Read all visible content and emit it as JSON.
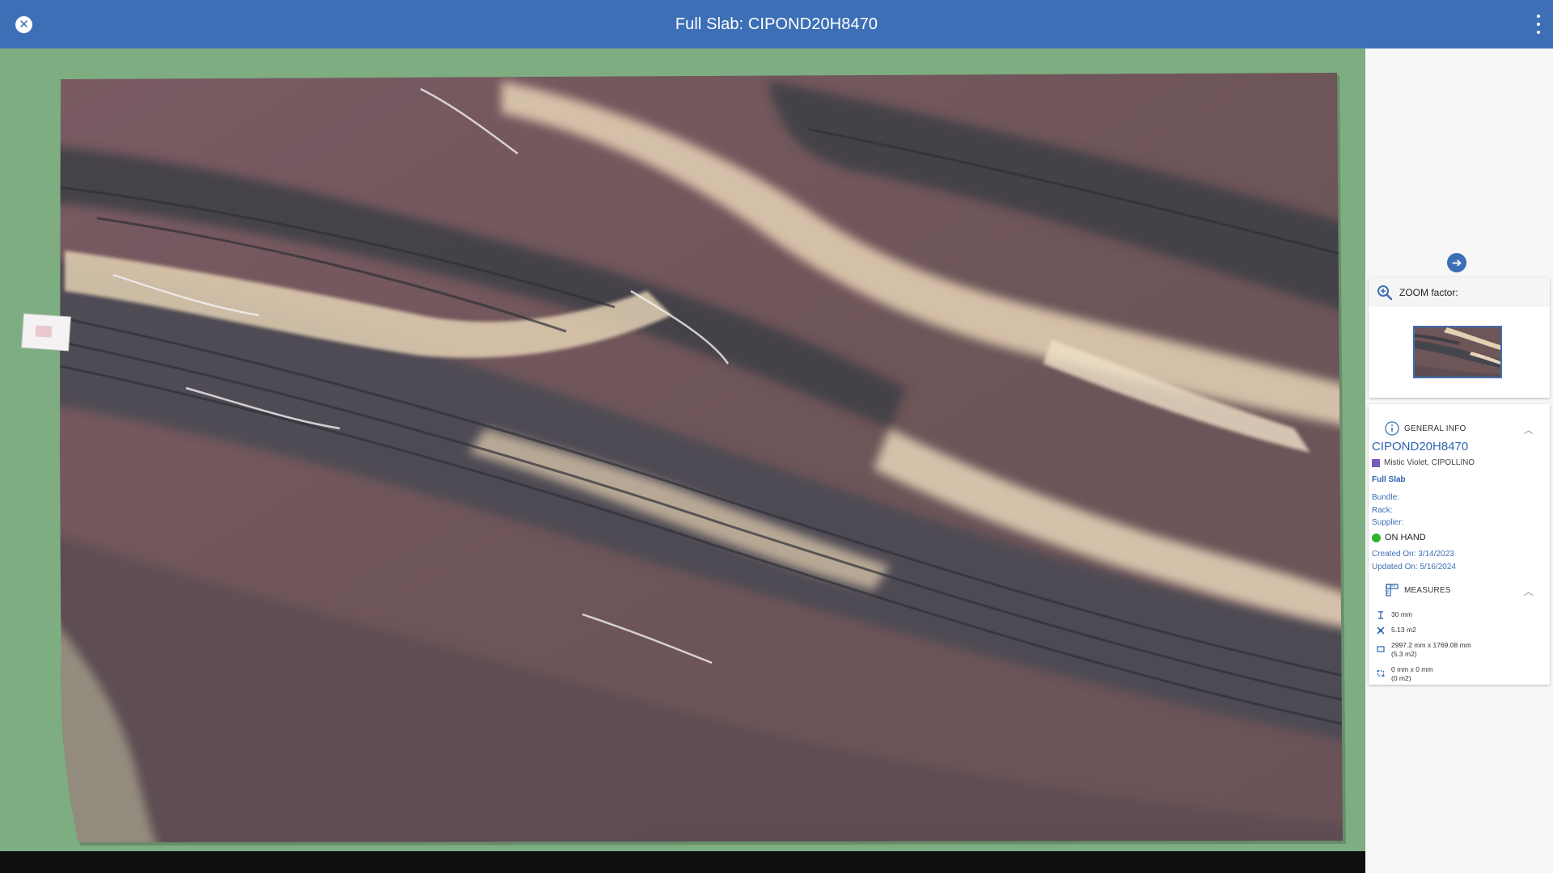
{
  "header": {
    "title": "Full Slab: CIPOND20H8470",
    "close_icon": "close-icon",
    "menu_icon": "kebab-menu-icon"
  },
  "colors": {
    "header_bg": "#3c6fb5",
    "viewer_bg": "#7ead82",
    "link_blue": "#2f64b0",
    "status_green": "#2db52f",
    "material_swatch": "#7a58bf"
  },
  "viewer": {
    "image_subject": "marble slab photo"
  },
  "side": {
    "next_icon": "arrow-right-icon",
    "zoom": {
      "label": "ZOOM factor:",
      "icon": "zoom-in-icon"
    },
    "general_info": {
      "title": "GENERAL INFO",
      "icon": "info-icon",
      "slab_id": "CIPOND20H8470",
      "material": "Mistic Violet, CIPOLLINO",
      "type": "Full Slab",
      "bundle": "Bundle:",
      "rack": "Rack:",
      "supplier": "Supplier:",
      "status": "ON HAND",
      "created": "Created On: 3/14/2023",
      "updated": "Updated On: 5/16/2024"
    },
    "measures": {
      "title": "MEASURES",
      "icon": "ruler-icon",
      "thickness": "30 mm",
      "area": "5.13 m2",
      "dimensions": "2997.2 mm x 1769.08 mm",
      "dimensions_area": "(5.3 m2)",
      "defect": "0 mm x 0 mm",
      "defect_area": "(0 m2)"
    }
  }
}
